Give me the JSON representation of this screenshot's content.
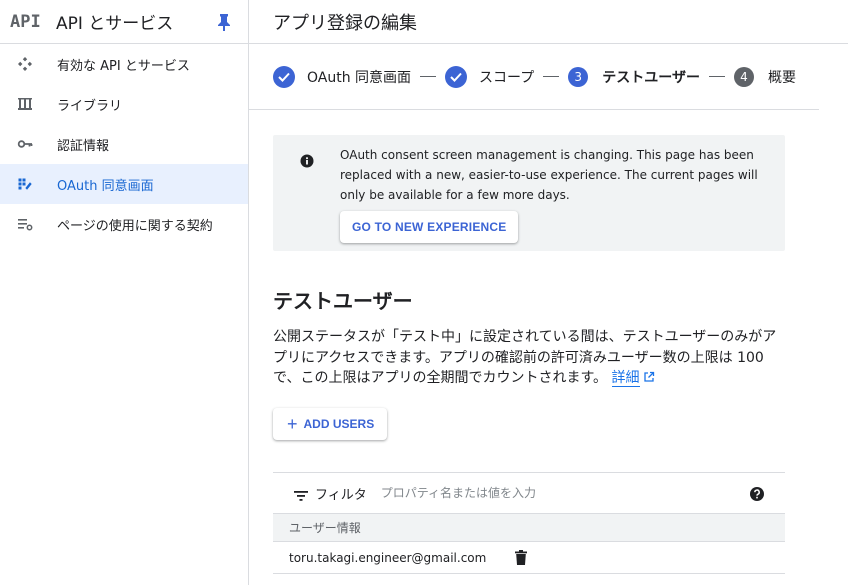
{
  "sidebar": {
    "logo": "API",
    "title": "API とサービス",
    "items": [
      {
        "label": "有効な API とサービス",
        "icon": "api-hub-icon"
      },
      {
        "label": "ライブラリ",
        "icon": "library-icon"
      },
      {
        "label": "認証情報",
        "icon": "key-icon"
      },
      {
        "label": "OAuth 同意画面",
        "icon": "consent-icon",
        "active": true
      },
      {
        "label": "ページの使用に関する契約",
        "icon": "settings-list-icon"
      }
    ]
  },
  "header": {
    "title": "アプリ登録の編集"
  },
  "stepper": {
    "steps": [
      {
        "label": "OAuth 同意画面",
        "state": "done"
      },
      {
        "label": "スコープ",
        "state": "done"
      },
      {
        "number": "3",
        "label": "テストユーザー",
        "state": "current"
      },
      {
        "number": "4",
        "label": "概要",
        "state": "todo"
      }
    ]
  },
  "notice": {
    "text": "OAuth consent screen management is changing. This page has been replaced with a new, easier-to-use experience. The current pages will only be available for a few more days.",
    "button": "GO TO NEW EXPERIENCE"
  },
  "section": {
    "title": "テストユーザー",
    "description": "公開ステータスが「テスト中」に設定されている間は、テストユーザーのみがアプリにアクセスできます。アプリの確認前の許可済みユーザー数の上限は 100 で、この上限はアプリの全期間でカウントされます。",
    "link": "詳細"
  },
  "add_users": {
    "label": "ADD USERS"
  },
  "table": {
    "filter_label": "フィルタ",
    "filter_placeholder": "プロパティ名または値を入力",
    "column_header": "ユーザー情報",
    "rows": [
      {
        "email": "toru.takagi.engineer@gmail.com"
      }
    ]
  },
  "colors": {
    "accent": "#3c64d4",
    "active_bg": "#e8f0fe",
    "active_text": "#1967d2"
  }
}
